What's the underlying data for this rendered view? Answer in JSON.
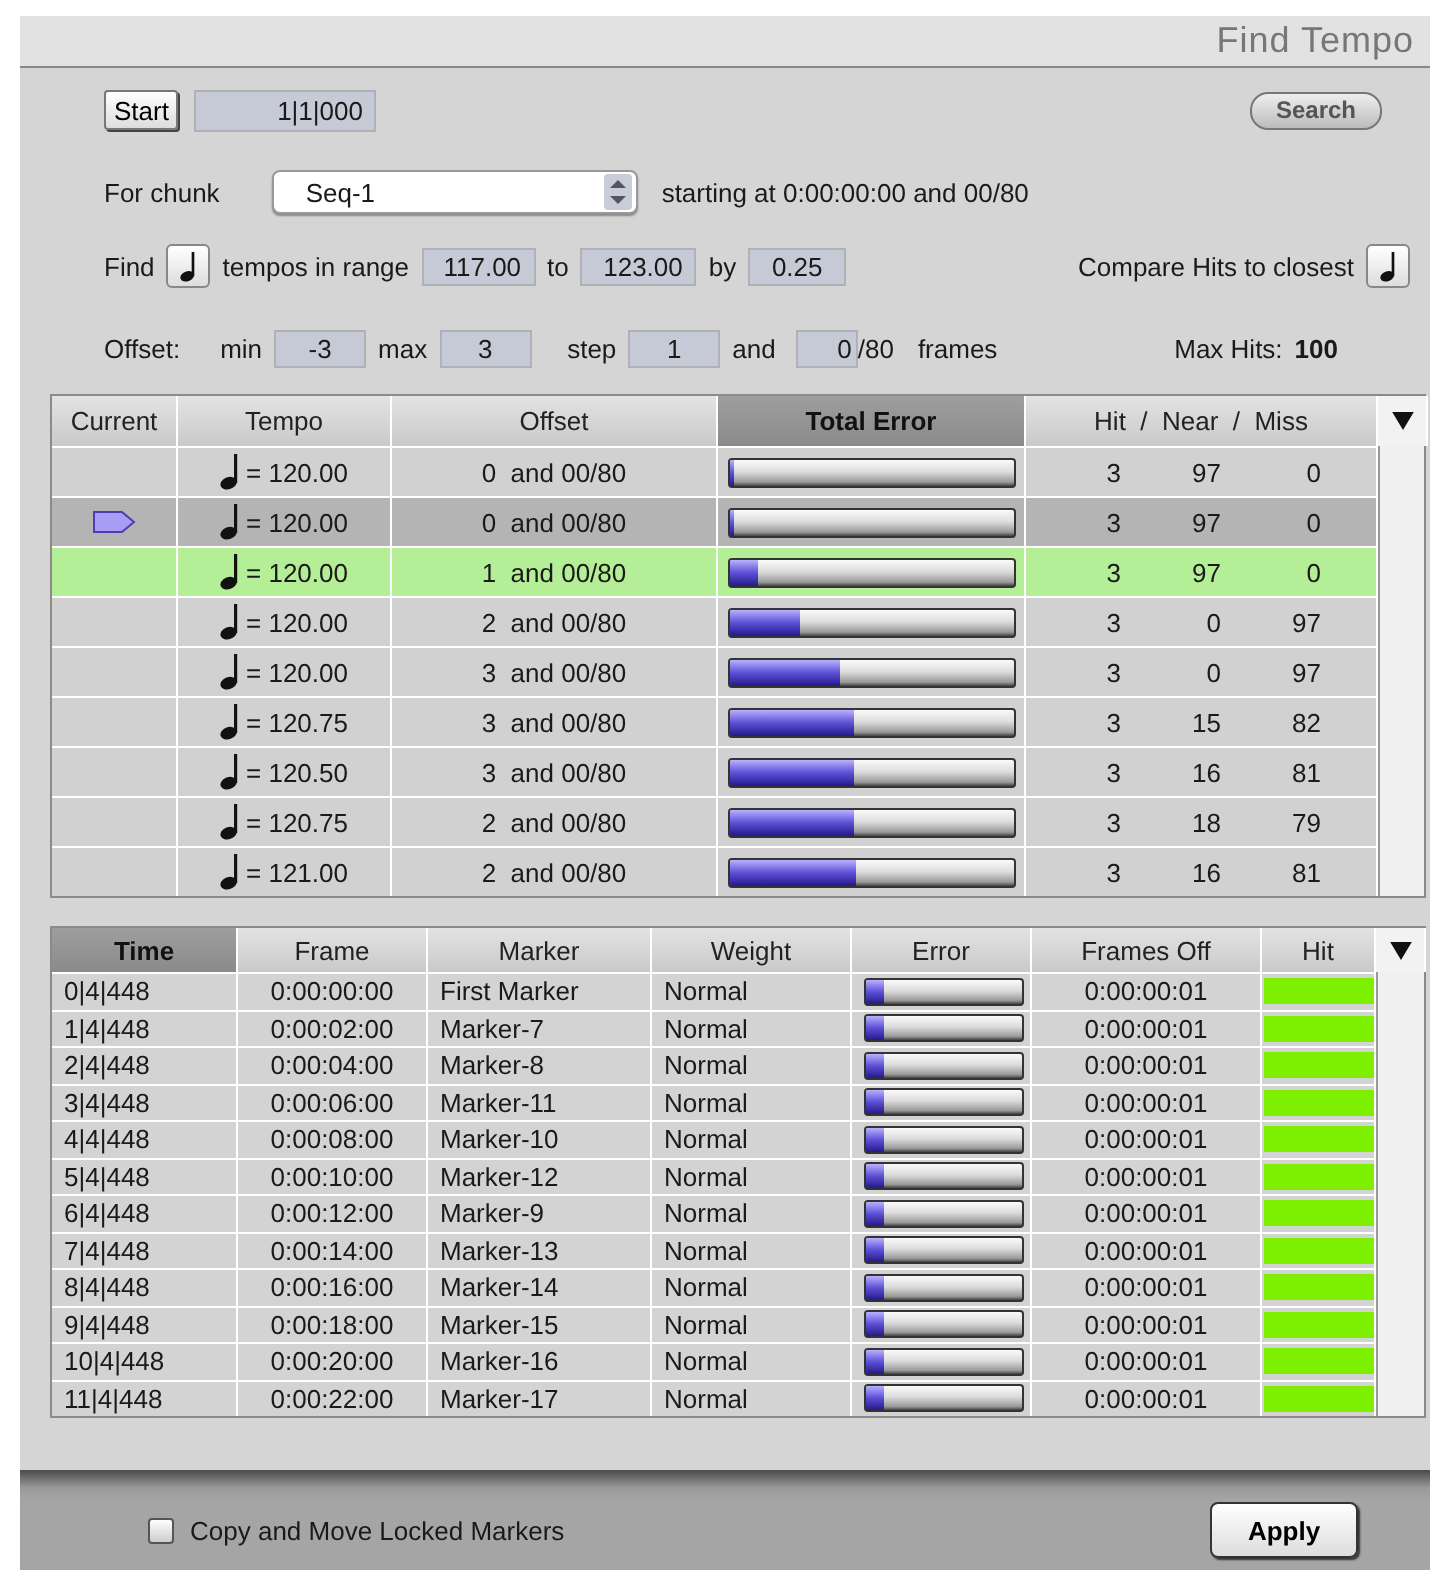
{
  "window": {
    "title": "Find Tempo"
  },
  "start": {
    "button": "Start",
    "value": "1|1|000"
  },
  "search_button": "Search",
  "chunk": {
    "label": "For chunk",
    "value": "Seq-1",
    "info": "starting at 0:00:00:00 and 00/80"
  },
  "find": {
    "label": "Find",
    "range_label": "tempos in range",
    "from": "117.00",
    "to_label": "to",
    "to": "123.00",
    "by_label": "by",
    "by": "0.25",
    "compare_label": "Compare Hits to closest"
  },
  "offset": {
    "label": "Offset:",
    "min_label": "min",
    "min": "-3",
    "max_label": "max",
    "max": "3",
    "step_label": "step",
    "step": "1",
    "and_label": "and",
    "frames": "0",
    "frames_unit": "/80",
    "frames_label": "frames",
    "max_hits_label": "Max Hits:",
    "max_hits": "100"
  },
  "tempo_table": {
    "columns": [
      {
        "label": "Current",
        "sorted": false
      },
      {
        "label": "Tempo",
        "sorted": false
      },
      {
        "label": "Offset",
        "sorted": false
      },
      {
        "label": "Total Error",
        "sorted": true
      },
      {
        "label": "Hit  /  Near  /  Miss",
        "sorted": false
      }
    ],
    "rows": [
      {
        "current": false,
        "selected": false,
        "tempo": "= 120.00",
        "offset": "0  and 00/80",
        "level": 0.02,
        "hit": "3",
        "near": "97",
        "miss": "0"
      },
      {
        "current": true,
        "selected": false,
        "tempo": "= 120.00",
        "offset": "0  and 00/80",
        "level": 0.02,
        "hit": "3",
        "near": "97",
        "miss": "0"
      },
      {
        "current": false,
        "selected": true,
        "tempo": "= 120.00",
        "offset": "1  and 00/80",
        "level": 0.1,
        "hit": "3",
        "near": "97",
        "miss": "0"
      },
      {
        "current": false,
        "selected": false,
        "tempo": "= 120.00",
        "offset": "2  and 00/80",
        "level": 0.25,
        "hit": "3",
        "near": "0",
        "miss": "97"
      },
      {
        "current": false,
        "selected": false,
        "tempo": "= 120.00",
        "offset": "3  and 00/80",
        "level": 0.39,
        "hit": "3",
        "near": "0",
        "miss": "97"
      },
      {
        "current": false,
        "selected": false,
        "tempo": "= 120.75",
        "offset": "3  and 00/80",
        "level": 0.44,
        "hit": "3",
        "near": "15",
        "miss": "82"
      },
      {
        "current": false,
        "selected": false,
        "tempo": "= 120.50",
        "offset": "3  and 00/80",
        "level": 0.44,
        "hit": "3",
        "near": "16",
        "miss": "81"
      },
      {
        "current": false,
        "selected": false,
        "tempo": "= 120.75",
        "offset": "2  and 00/80",
        "level": 0.44,
        "hit": "3",
        "near": "18",
        "miss": "79"
      },
      {
        "current": false,
        "selected": false,
        "tempo": "= 121.00",
        "offset": "2  and 00/80",
        "level": 0.45,
        "hit": "3",
        "near": "16",
        "miss": "81"
      }
    ]
  },
  "marker_table": {
    "columns": [
      {
        "label": "Time",
        "sorted": true
      },
      {
        "label": "Frame",
        "sorted": false
      },
      {
        "label": "Marker",
        "sorted": false
      },
      {
        "label": "Weight",
        "sorted": false
      },
      {
        "label": "Error",
        "sorted": false
      },
      {
        "label": "Frames Off",
        "sorted": false
      },
      {
        "label": "Hit",
        "sorted": false
      }
    ],
    "rows": [
      {
        "time": "0|4|448",
        "frame": "0:00:00:00",
        "marker": "First Marker",
        "weight": "Normal",
        "level": 0.12,
        "frames_off": "0:00:00:01",
        "hit": true
      },
      {
        "time": "1|4|448",
        "frame": "0:00:02:00",
        "marker": "Marker-7",
        "weight": "Normal",
        "level": 0.12,
        "frames_off": "0:00:00:01",
        "hit": true
      },
      {
        "time": "2|4|448",
        "frame": "0:00:04:00",
        "marker": "Marker-8",
        "weight": "Normal",
        "level": 0.12,
        "frames_off": "0:00:00:01",
        "hit": true
      },
      {
        "time": "3|4|448",
        "frame": "0:00:06:00",
        "marker": "Marker-11",
        "weight": "Normal",
        "level": 0.12,
        "frames_off": "0:00:00:01",
        "hit": true
      },
      {
        "time": "4|4|448",
        "frame": "0:00:08:00",
        "marker": "Marker-10",
        "weight": "Normal",
        "level": 0.12,
        "frames_off": "0:00:00:01",
        "hit": true
      },
      {
        "time": "5|4|448",
        "frame": "0:00:10:00",
        "marker": "Marker-12",
        "weight": "Normal",
        "level": 0.12,
        "frames_off": "0:00:00:01",
        "hit": true
      },
      {
        "time": "6|4|448",
        "frame": "0:00:12:00",
        "marker": "Marker-9",
        "weight": "Normal",
        "level": 0.12,
        "frames_off": "0:00:00:01",
        "hit": true
      },
      {
        "time": "7|4|448",
        "frame": "0:00:14:00",
        "marker": "Marker-13",
        "weight": "Normal",
        "level": 0.12,
        "frames_off": "0:00:00:01",
        "hit": true
      },
      {
        "time": "8|4|448",
        "frame": "0:00:16:00",
        "marker": "Marker-14",
        "weight": "Normal",
        "level": 0.12,
        "frames_off": "0:00:00:01",
        "hit": true
      },
      {
        "time": "9|4|448",
        "frame": "0:00:18:00",
        "marker": "Marker-15",
        "weight": "Normal",
        "level": 0.12,
        "frames_off": "0:00:00:01",
        "hit": true
      },
      {
        "time": "10|4|448",
        "frame": "0:00:20:00",
        "marker": "Marker-16",
        "weight": "Normal",
        "level": 0.12,
        "frames_off": "0:00:00:01",
        "hit": true
      },
      {
        "time": "11|4|448",
        "frame": "0:00:22:00",
        "marker": "Marker-17",
        "weight": "Normal",
        "level": 0.12,
        "frames_off": "0:00:00:01",
        "hit": true
      }
    ]
  },
  "copy_locked": {
    "label": "Copy and Move Locked Markers",
    "checked": false
  },
  "apply_button": "Apply"
}
